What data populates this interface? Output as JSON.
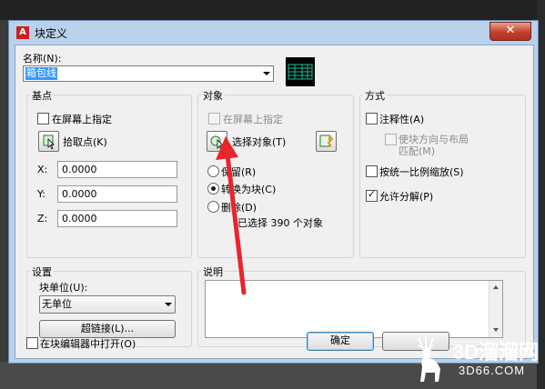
{
  "dialog": {
    "title": "块定义",
    "close_glyph": "✕",
    "name_label": "名称(N):",
    "name_value": "箱包线",
    "preview_icon": "block-preview-thumbnail"
  },
  "base_point": {
    "title": "基点",
    "specify_on_screen": "在屏幕上指定",
    "pick_point": "拾取点(K)",
    "x_label": "X:",
    "y_label": "Y:",
    "z_label": "Z:",
    "x_value": "0.0000",
    "y_value": "0.0000",
    "z_value": "0.0000"
  },
  "objects": {
    "title": "对象",
    "specify_on_screen": "在屏幕上指定",
    "select_objects": "选择对象(T)",
    "retain": "保留(R)",
    "convert_to_block": "转换为块(C)",
    "delete": "删除(D)",
    "selected_count": "已选择 390 个对象"
  },
  "behavior": {
    "title": "方式",
    "annotative": "注释性(A)",
    "match_orientation": "使块方向与布局",
    "match_orientation_2": "匹配(M)",
    "scale_uniformly": "按统一比例缩放(S)",
    "allow_exploding": "允许分解(P)"
  },
  "settings": {
    "title": "设置",
    "block_unit_label": "块单位(U):",
    "block_unit_value": "无单位",
    "hyperlink": "超链接(L)..."
  },
  "description": {
    "title": "说明"
  },
  "footer": {
    "open_in_editor": "在块编辑器中打开(O)",
    "ok": "确定"
  },
  "watermark": {
    "main": "3D溜溜网",
    "sub": "3D66.COM"
  },
  "colors": {
    "dialog_frame": "#b9d1ea",
    "close_button": "#c4402c",
    "selection": "#3399ff",
    "annotation_arrow": "#e8252b"
  }
}
